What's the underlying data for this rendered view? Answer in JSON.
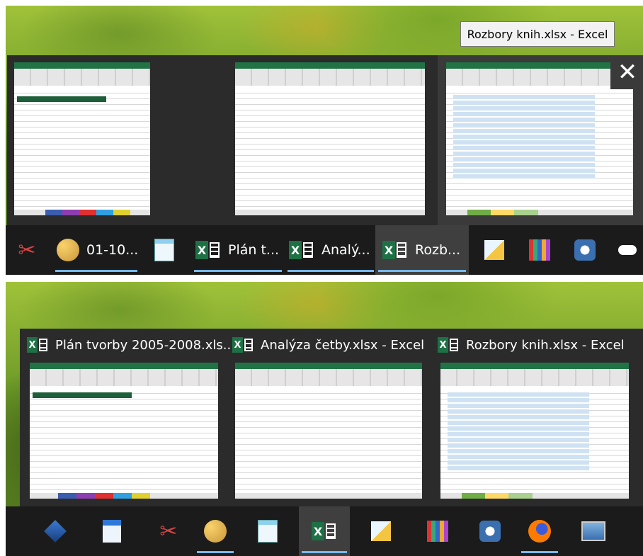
{
  "top": {
    "tooltip": "Rozbory knih.xlsx - Excel",
    "close_symbol": "✕",
    "taskbar": {
      "items": [
        {
          "icon": "paint-scissors-icon"
        },
        {
          "icon": "paint-palette-icon",
          "label": "01-10..."
        },
        {
          "icon": "notepad-icon"
        },
        {
          "icon": "excel-icon",
          "label": "Plán t..."
        },
        {
          "icon": "excel-icon",
          "label": "Analý..."
        },
        {
          "icon": "excel-icon",
          "label": "Rozb..."
        },
        {
          "icon": "pen-icon"
        },
        {
          "icon": "books-icon"
        },
        {
          "icon": "media-icon"
        },
        {
          "icon": "cloud-icon"
        }
      ]
    }
  },
  "bottom": {
    "thumbnails": [
      {
        "title": "Plán tvorby 2005-2008.xls..."
      },
      {
        "title": "Analýza četby.xlsx - Excel"
      },
      {
        "title": "Rozbory knih.xlsx - Excel"
      }
    ],
    "taskbar": {
      "items": [
        {
          "icon": "virtualbox-icon"
        },
        {
          "icon": "document-a-icon"
        },
        {
          "icon": "paint-scissors-icon"
        },
        {
          "icon": "paint-palette-icon"
        },
        {
          "icon": "notepad-icon"
        },
        {
          "icon": "excel-icon"
        },
        {
          "icon": "pen-icon"
        },
        {
          "icon": "books-icon"
        },
        {
          "icon": "media-icon"
        },
        {
          "icon": "firefox-icon"
        },
        {
          "icon": "monitor-icon"
        }
      ]
    }
  },
  "colors": {
    "taskbar": "#1b1b1b",
    "active": "#3f3f3f",
    "indicator": "#76b9ed",
    "excel_green": "#217346"
  }
}
